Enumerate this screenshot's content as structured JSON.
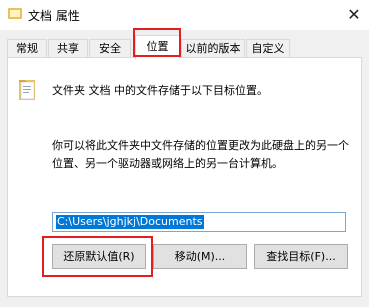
{
  "window": {
    "title": "文档 属性",
    "close_glyph": "✕"
  },
  "tabs": [
    {
      "label": "常规"
    },
    {
      "label": "共享"
    },
    {
      "label": "安全"
    },
    {
      "label": "位置",
      "active": true
    },
    {
      "label": "以前的版本"
    },
    {
      "label": "自定义"
    }
  ],
  "location": {
    "info": "文件夹 文档 中的文件存储于以下目标位置。",
    "description_line1": "你可以将此文件夹中文件存储的位置更改为此硬盘上的另一个",
    "description_line2": "位置、另一个驱动器或网络上的另一台计算机。",
    "path_value": "C:\\Users\\jghjkj\\Documents"
  },
  "buttons": {
    "restore_default": "还原默认值(R)",
    "move": "移动(M)...",
    "find_target": "查找目标(F)..."
  },
  "colors": {
    "highlight": "#e02020",
    "selection": "#0078d7",
    "folder": "#e9c25a"
  }
}
